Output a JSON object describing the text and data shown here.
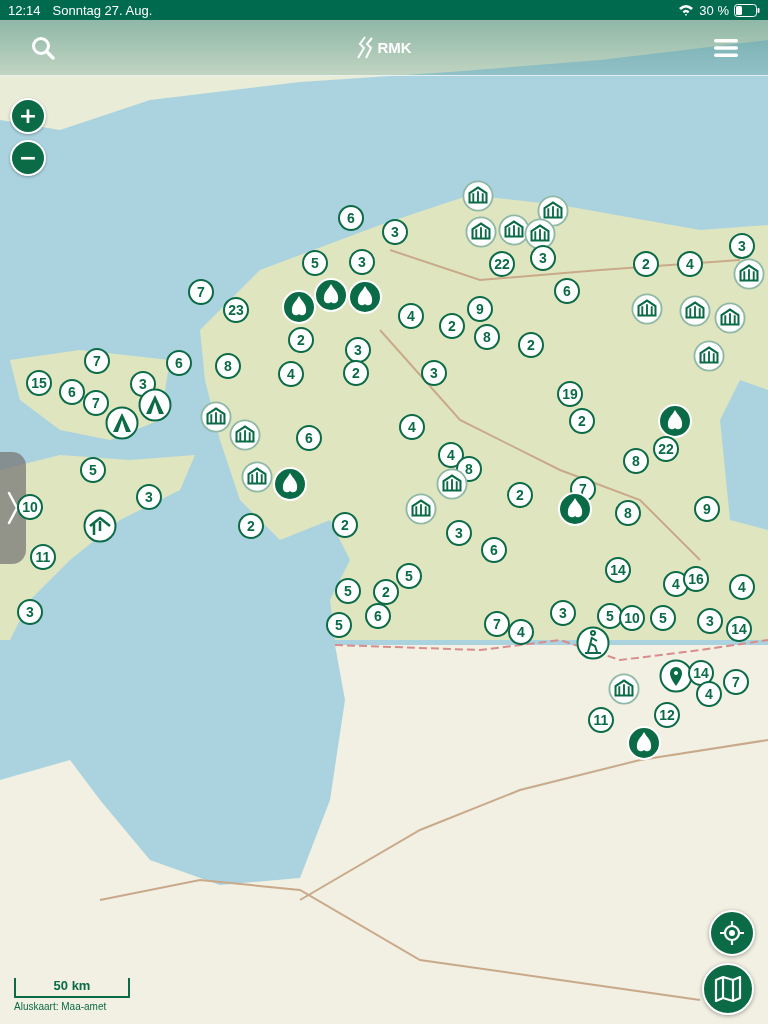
{
  "status_bar": {
    "time": "12:14",
    "date": "Sonntag 27. Aug.",
    "battery": "30 %"
  },
  "header": {
    "logo": "RMK"
  },
  "zoom": {
    "in": "+",
    "out": "−"
  },
  "markers": [
    {
      "kind": "cabin"
    },
    {
      "kind": "cabin"
    },
    {
      "kind": "count",
      "label": "6"
    },
    {
      "kind": "count",
      "label": "3"
    },
    {
      "kind": "cabin"
    },
    {
      "kind": "cabin"
    },
    {
      "kind": "cabin"
    },
    {
      "kind": "count",
      "label": "3"
    },
    {
      "kind": "count",
      "label": "5"
    },
    {
      "kind": "count",
      "label": "3"
    },
    {
      "kind": "count",
      "label": "22"
    },
    {
      "kind": "count",
      "label": "3"
    },
    {
      "kind": "count",
      "label": "2"
    },
    {
      "kind": "count",
      "label": "4"
    },
    {
      "kind": "cabin"
    },
    {
      "kind": "count",
      "label": "7"
    },
    {
      "kind": "fire"
    },
    {
      "kind": "fire"
    },
    {
      "kind": "count",
      "label": "6"
    },
    {
      "kind": "count",
      "label": "23"
    },
    {
      "kind": "fire"
    },
    {
      "kind": "count",
      "label": "9"
    },
    {
      "kind": "cabin"
    },
    {
      "kind": "cabin"
    },
    {
      "kind": "count",
      "label": "4"
    },
    {
      "kind": "cabin"
    },
    {
      "kind": "count",
      "label": "2"
    },
    {
      "kind": "count",
      "label": "2"
    },
    {
      "kind": "count",
      "label": "8"
    },
    {
      "kind": "count",
      "label": "2"
    },
    {
      "kind": "count",
      "label": "3"
    },
    {
      "kind": "cabin"
    },
    {
      "kind": "count",
      "label": "7"
    },
    {
      "kind": "count",
      "label": "6"
    },
    {
      "kind": "count",
      "label": "8"
    },
    {
      "kind": "count",
      "label": "4"
    },
    {
      "kind": "count",
      "label": "2"
    },
    {
      "kind": "count",
      "label": "3"
    },
    {
      "kind": "count",
      "label": "15"
    },
    {
      "kind": "count",
      "label": "3"
    },
    {
      "kind": "count",
      "label": "6"
    },
    {
      "kind": "count",
      "label": "19"
    },
    {
      "kind": "count",
      "label": "7"
    },
    {
      "kind": "tent"
    },
    {
      "kind": "cabin"
    },
    {
      "kind": "tent"
    },
    {
      "kind": "count",
      "label": "4"
    },
    {
      "kind": "count",
      "label": "2"
    },
    {
      "kind": "fire"
    },
    {
      "kind": "cabin"
    },
    {
      "kind": "count",
      "label": "6"
    },
    {
      "kind": "count",
      "label": "22"
    },
    {
      "kind": "count",
      "label": "4"
    },
    {
      "kind": "count",
      "label": "8"
    },
    {
      "kind": "count",
      "label": "5"
    },
    {
      "kind": "count",
      "label": "8"
    },
    {
      "kind": "cabin"
    },
    {
      "kind": "fire"
    },
    {
      "kind": "cabin"
    },
    {
      "kind": "count",
      "label": "7"
    },
    {
      "kind": "count",
      "label": "3"
    },
    {
      "kind": "count",
      "label": "2"
    },
    {
      "kind": "count",
      "label": "10"
    },
    {
      "kind": "cabin"
    },
    {
      "kind": "fire"
    },
    {
      "kind": "count",
      "label": "8"
    },
    {
      "kind": "count",
      "label": "9"
    },
    {
      "kind": "shelter"
    },
    {
      "kind": "count",
      "label": "2"
    },
    {
      "kind": "count",
      "label": "2"
    },
    {
      "kind": "count",
      "label": "3"
    },
    {
      "kind": "count",
      "label": "6"
    },
    {
      "kind": "count",
      "label": "11"
    },
    {
      "kind": "count",
      "label": "14"
    },
    {
      "kind": "count",
      "label": "5"
    },
    {
      "kind": "count",
      "label": "4"
    },
    {
      "kind": "count",
      "label": "16"
    },
    {
      "kind": "count",
      "label": "4"
    },
    {
      "kind": "count",
      "label": "5"
    },
    {
      "kind": "count",
      "label": "2"
    },
    {
      "kind": "count",
      "label": "3"
    },
    {
      "kind": "count",
      "label": "5"
    },
    {
      "kind": "count",
      "label": "6"
    },
    {
      "kind": "count",
      "label": "7"
    },
    {
      "kind": "count",
      "label": "4"
    },
    {
      "kind": "count",
      "label": "3"
    },
    {
      "kind": "count",
      "label": "5"
    },
    {
      "kind": "count",
      "label": "10"
    },
    {
      "kind": "count",
      "label": "5"
    },
    {
      "kind": "count",
      "label": "3"
    },
    {
      "kind": "count",
      "label": "14"
    },
    {
      "kind": "hiker"
    },
    {
      "kind": "pin"
    },
    {
      "kind": "count",
      "label": "14"
    },
    {
      "kind": "count",
      "label": "7"
    },
    {
      "kind": "cabin"
    },
    {
      "kind": "count",
      "label": "4"
    },
    {
      "kind": "count",
      "label": "11"
    },
    {
      "kind": "count",
      "label": "12"
    },
    {
      "kind": "fire"
    }
  ],
  "scale": {
    "label": "50 km",
    "attribution": "Aluskaart: Maa-amet"
  }
}
